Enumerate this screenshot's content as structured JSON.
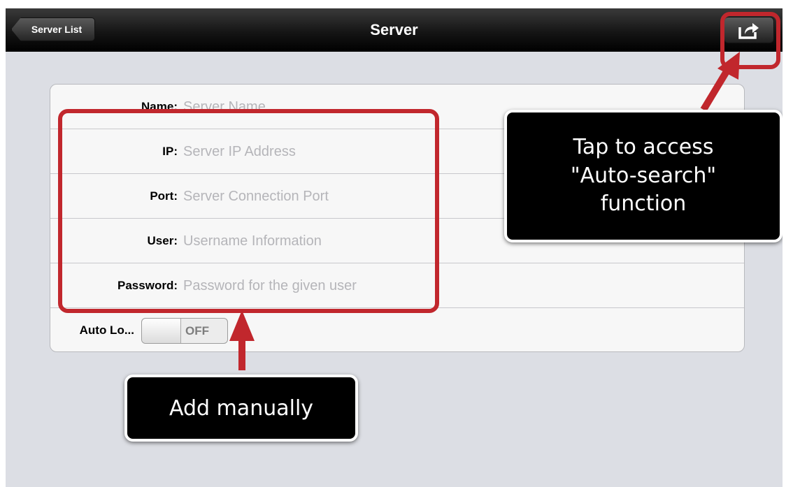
{
  "navbar": {
    "title": "Server",
    "back_label": "Server List"
  },
  "form": {
    "rows": [
      {
        "label": "Name:",
        "placeholder": "Server Name"
      },
      {
        "label": "IP:",
        "placeholder": "Server IP Address"
      },
      {
        "label": "Port:",
        "placeholder": "Server Connection Port"
      },
      {
        "label": "User:",
        "placeholder": "Username Information"
      },
      {
        "label": "Password:",
        "placeholder": "Password for the given user"
      }
    ],
    "auto_login": {
      "label": "Auto Lo...",
      "state": "OFF"
    }
  },
  "annotations": {
    "manual_callout": "Add manually",
    "autosearch_callout": {
      "line1": "Tap to access",
      "line2": "\"Auto-search\"",
      "line3": "function"
    }
  },
  "colors": {
    "highlight": "#c1272d",
    "background": "#dcdee4",
    "placeholder": "#b5b5b9"
  }
}
